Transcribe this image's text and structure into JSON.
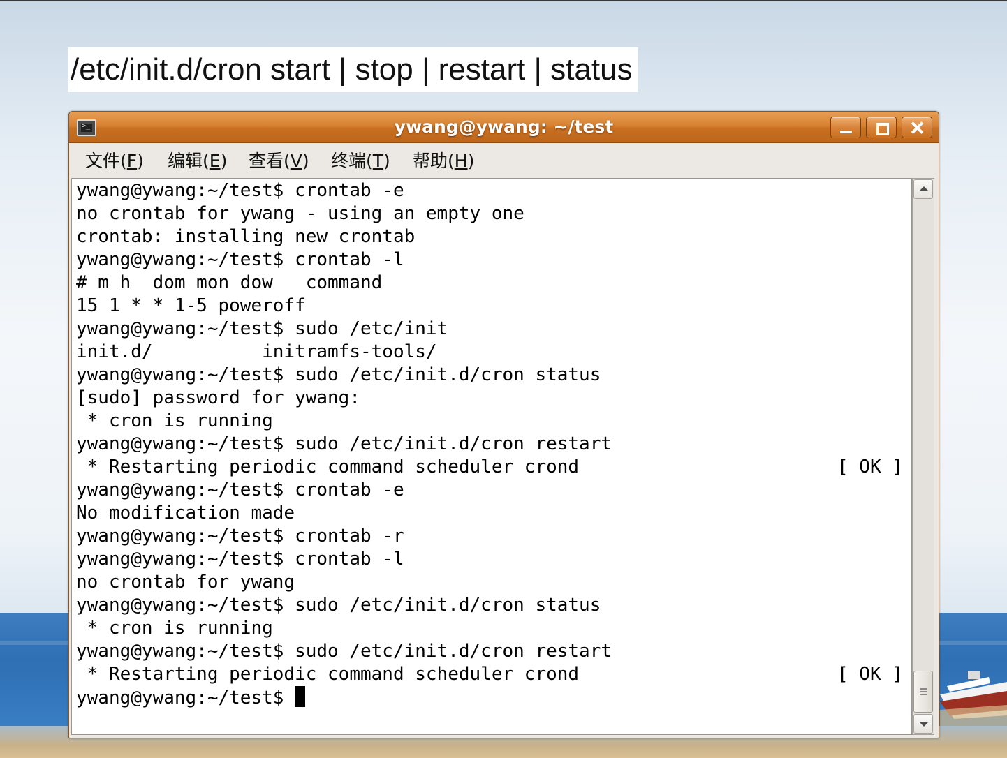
{
  "slide": {
    "title": "/etc/init.d/cron start | stop | restart | status"
  },
  "window": {
    "title": "ywang@ywang: ~/test",
    "icon": "terminal-icon",
    "controls": [
      "minimize-icon",
      "maximize-icon",
      "close-icon"
    ]
  },
  "menu": [
    {
      "text": "文件(",
      "mnemonic": "F",
      "close": ")"
    },
    {
      "text": "编辑(",
      "mnemonic": "E",
      "close": ")"
    },
    {
      "text": "查看(",
      "mnemonic": "V",
      "close": ")"
    },
    {
      "text": "终端(",
      "mnemonic": "T",
      "close": ")"
    },
    {
      "text": "帮助(",
      "mnemonic": "H",
      "close": ")"
    }
  ],
  "terminal": {
    "lines": [
      {
        "text": "ywang@ywang:~/test$ crontab -e"
      },
      {
        "text": "no crontab for ywang - using an empty one"
      },
      {
        "text": "crontab: installing new crontab"
      },
      {
        "text": "ywang@ywang:~/test$ crontab -l"
      },
      {
        "text": "# m h  dom mon dow   command"
      },
      {
        "text": "15 1 * * 1-5 poweroff"
      },
      {
        "text": "ywang@ywang:~/test$ sudo /etc/init"
      },
      {
        "text": "init.d/          initramfs-tools/"
      },
      {
        "text": "ywang@ywang:~/test$ sudo /etc/init.d/cron status"
      },
      {
        "text": "[sudo] password for ywang:"
      },
      {
        "text": " * cron is running"
      },
      {
        "text": "ywang@ywang:~/test$ sudo /etc/init.d/cron restart"
      },
      {
        "text": " * Restarting periodic command scheduler crond",
        "status": "[ OK ]"
      },
      {
        "text": "ywang@ywang:~/test$ crontab -e"
      },
      {
        "text": "No modification made"
      },
      {
        "text": "ywang@ywang:~/test$ crontab -r"
      },
      {
        "text": "ywang@ywang:~/test$ crontab -l"
      },
      {
        "text": "no crontab for ywang"
      },
      {
        "text": "ywang@ywang:~/test$ sudo /etc/init.d/cron status"
      },
      {
        "text": " * cron is running"
      },
      {
        "text": "ywang@ywang:~/test$ sudo /etc/init.d/cron restart"
      },
      {
        "text": " * Restarting periodic command scheduler crond",
        "status": "[ OK ]"
      },
      {
        "text": "ywang@ywang:~/test$ ",
        "cursor": true
      }
    ]
  }
}
